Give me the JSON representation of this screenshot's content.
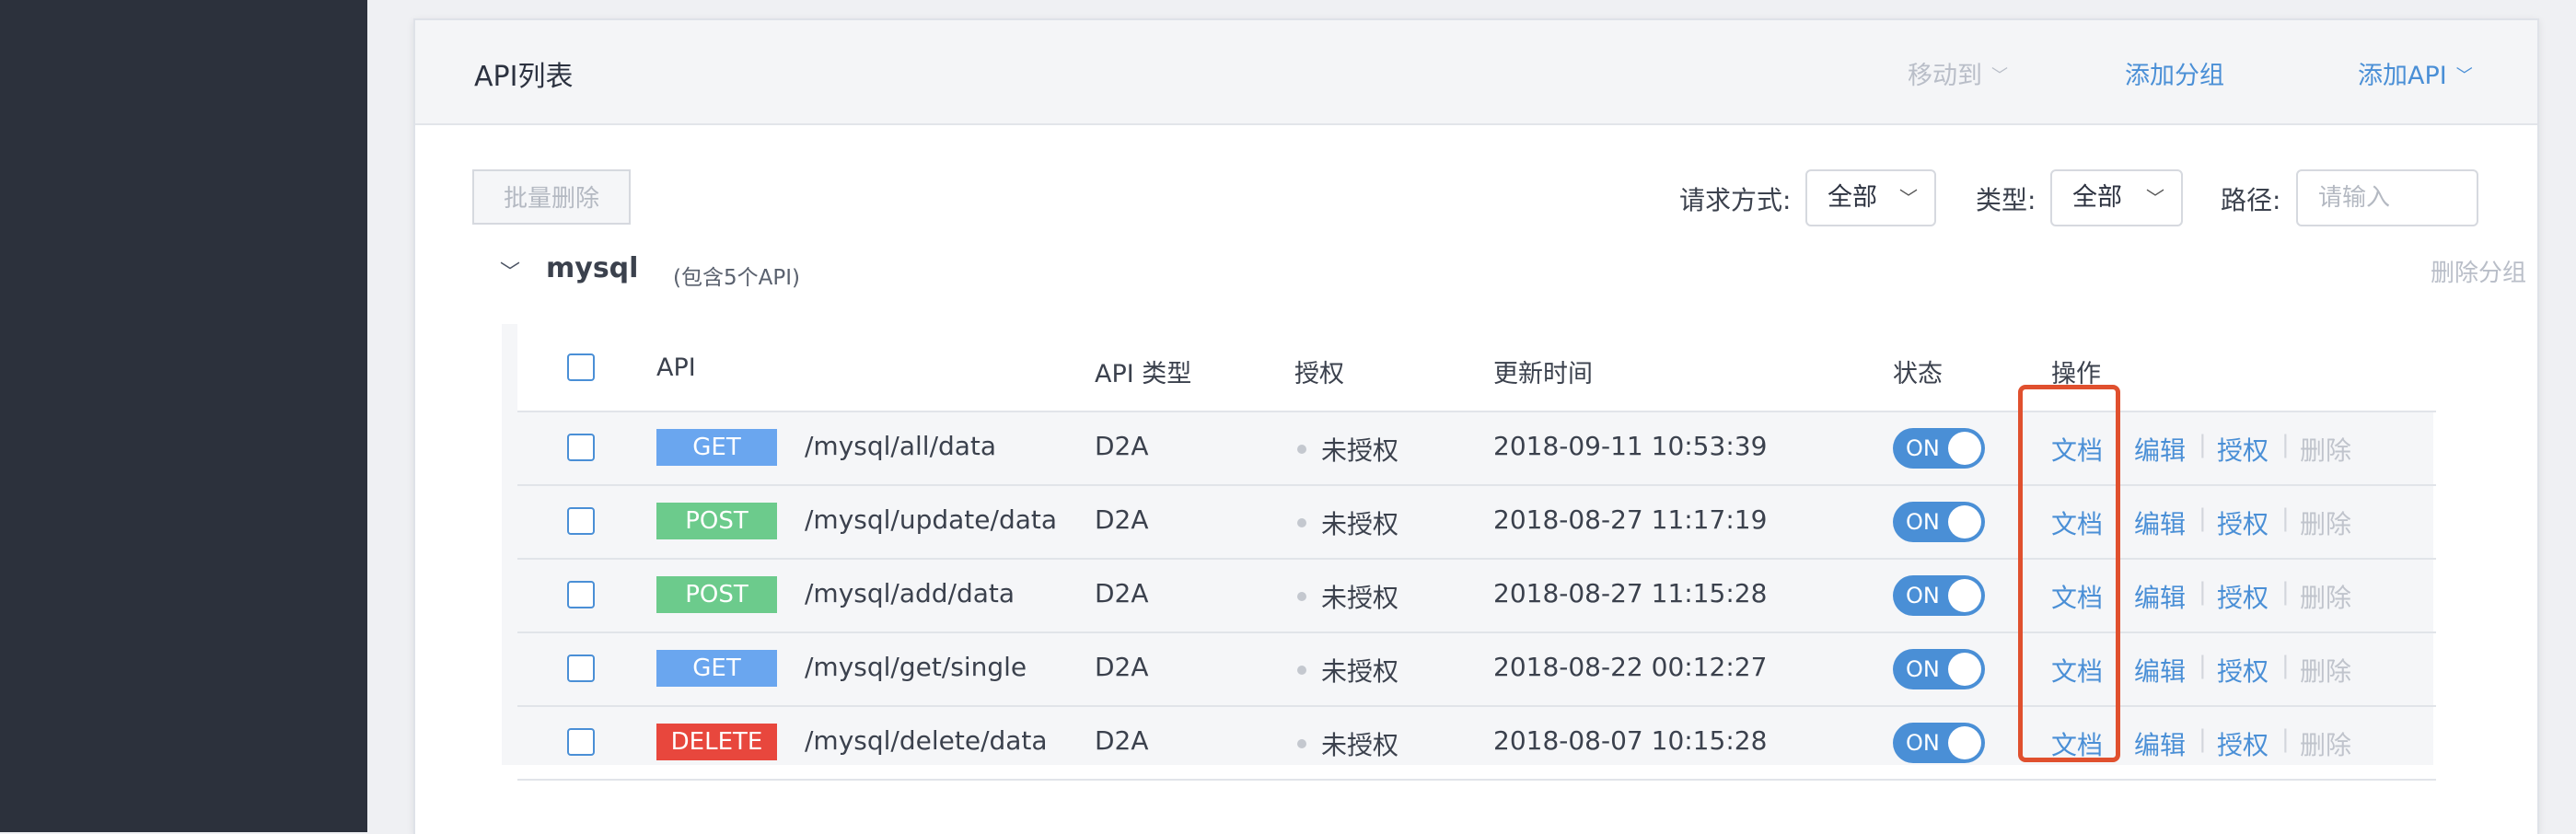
{
  "panel": {
    "title": "API列表",
    "move_to": "移动到",
    "add_group": "添加分组",
    "add_api": "添加API"
  },
  "toolbar": {
    "batch_delete": "批量删除",
    "method_label": "请求方式:",
    "method_value": "全部",
    "type_label": "类型:",
    "type_value": "全部",
    "path_label": "路径:",
    "path_placeholder": "请输入"
  },
  "group": {
    "name": "mysql",
    "count_text": "(包含5个API)",
    "delete_label": "删除分组"
  },
  "table": {
    "columns": [
      "API",
      "API 类型",
      "授权",
      "更新时间",
      "状态",
      "操作"
    ],
    "rows": [
      {
        "method": "GET",
        "path": "/mysql/all/data",
        "type": "D2A",
        "auth": "未授权",
        "updated": "2018-09-11 10:53:39",
        "status": "ON"
      },
      {
        "method": "POST",
        "path": "/mysql/update/data",
        "type": "D2A",
        "auth": "未授权",
        "updated": "2018-08-27 11:17:19",
        "status": "ON"
      },
      {
        "method": "POST",
        "path": "/mysql/add/data",
        "type": "D2A",
        "auth": "未授权",
        "updated": "2018-08-27 11:15:28",
        "status": "ON"
      },
      {
        "method": "GET",
        "path": "/mysql/get/single",
        "type": "D2A",
        "auth": "未授权",
        "updated": "2018-08-22 00:12:27",
        "status": "ON"
      },
      {
        "method": "DELETE",
        "path": "/mysql/delete/data",
        "type": "D2A",
        "auth": "未授权",
        "updated": "2018-08-07 10:15:28",
        "status": "ON"
      }
    ],
    "actions": {
      "doc": "文档",
      "edit": "编辑",
      "authorize": "授权",
      "delete": "删除"
    }
  },
  "colors": {
    "accent": "#4a8fd6",
    "get": "#6aa6ef",
    "post": "#6ccb8c",
    "delete": "#e8473d",
    "highlight": "#e0502e",
    "sidebar": "#2c313c"
  }
}
